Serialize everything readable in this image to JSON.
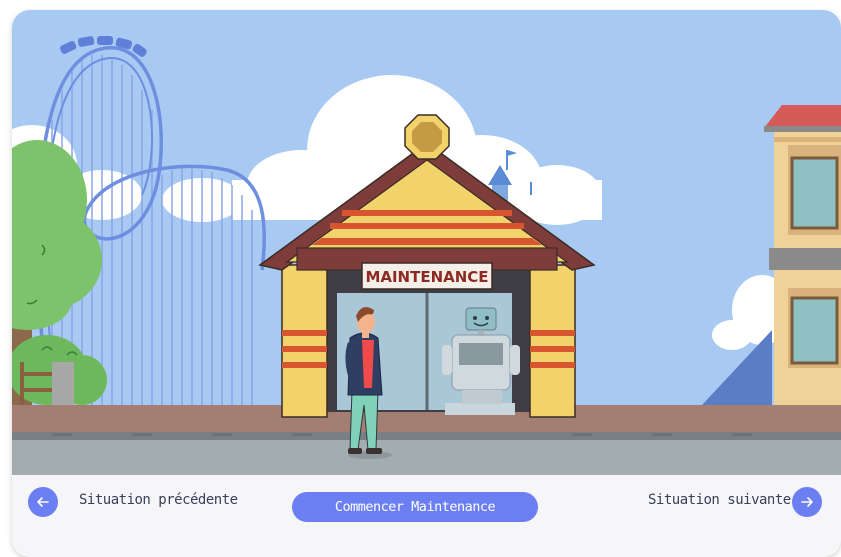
{
  "scene": {
    "sign_text": "MAINTENANCE",
    "sky_color": "#a8c9f2",
    "accent_color": "#6b7ff3"
  },
  "nav": {
    "prev_label": "Situation précédente",
    "prev_icon": "arrow-left-icon",
    "start_label": "Commencer Maintenance",
    "next_label": "Situation suivante",
    "next_icon": "arrow-right-icon"
  }
}
